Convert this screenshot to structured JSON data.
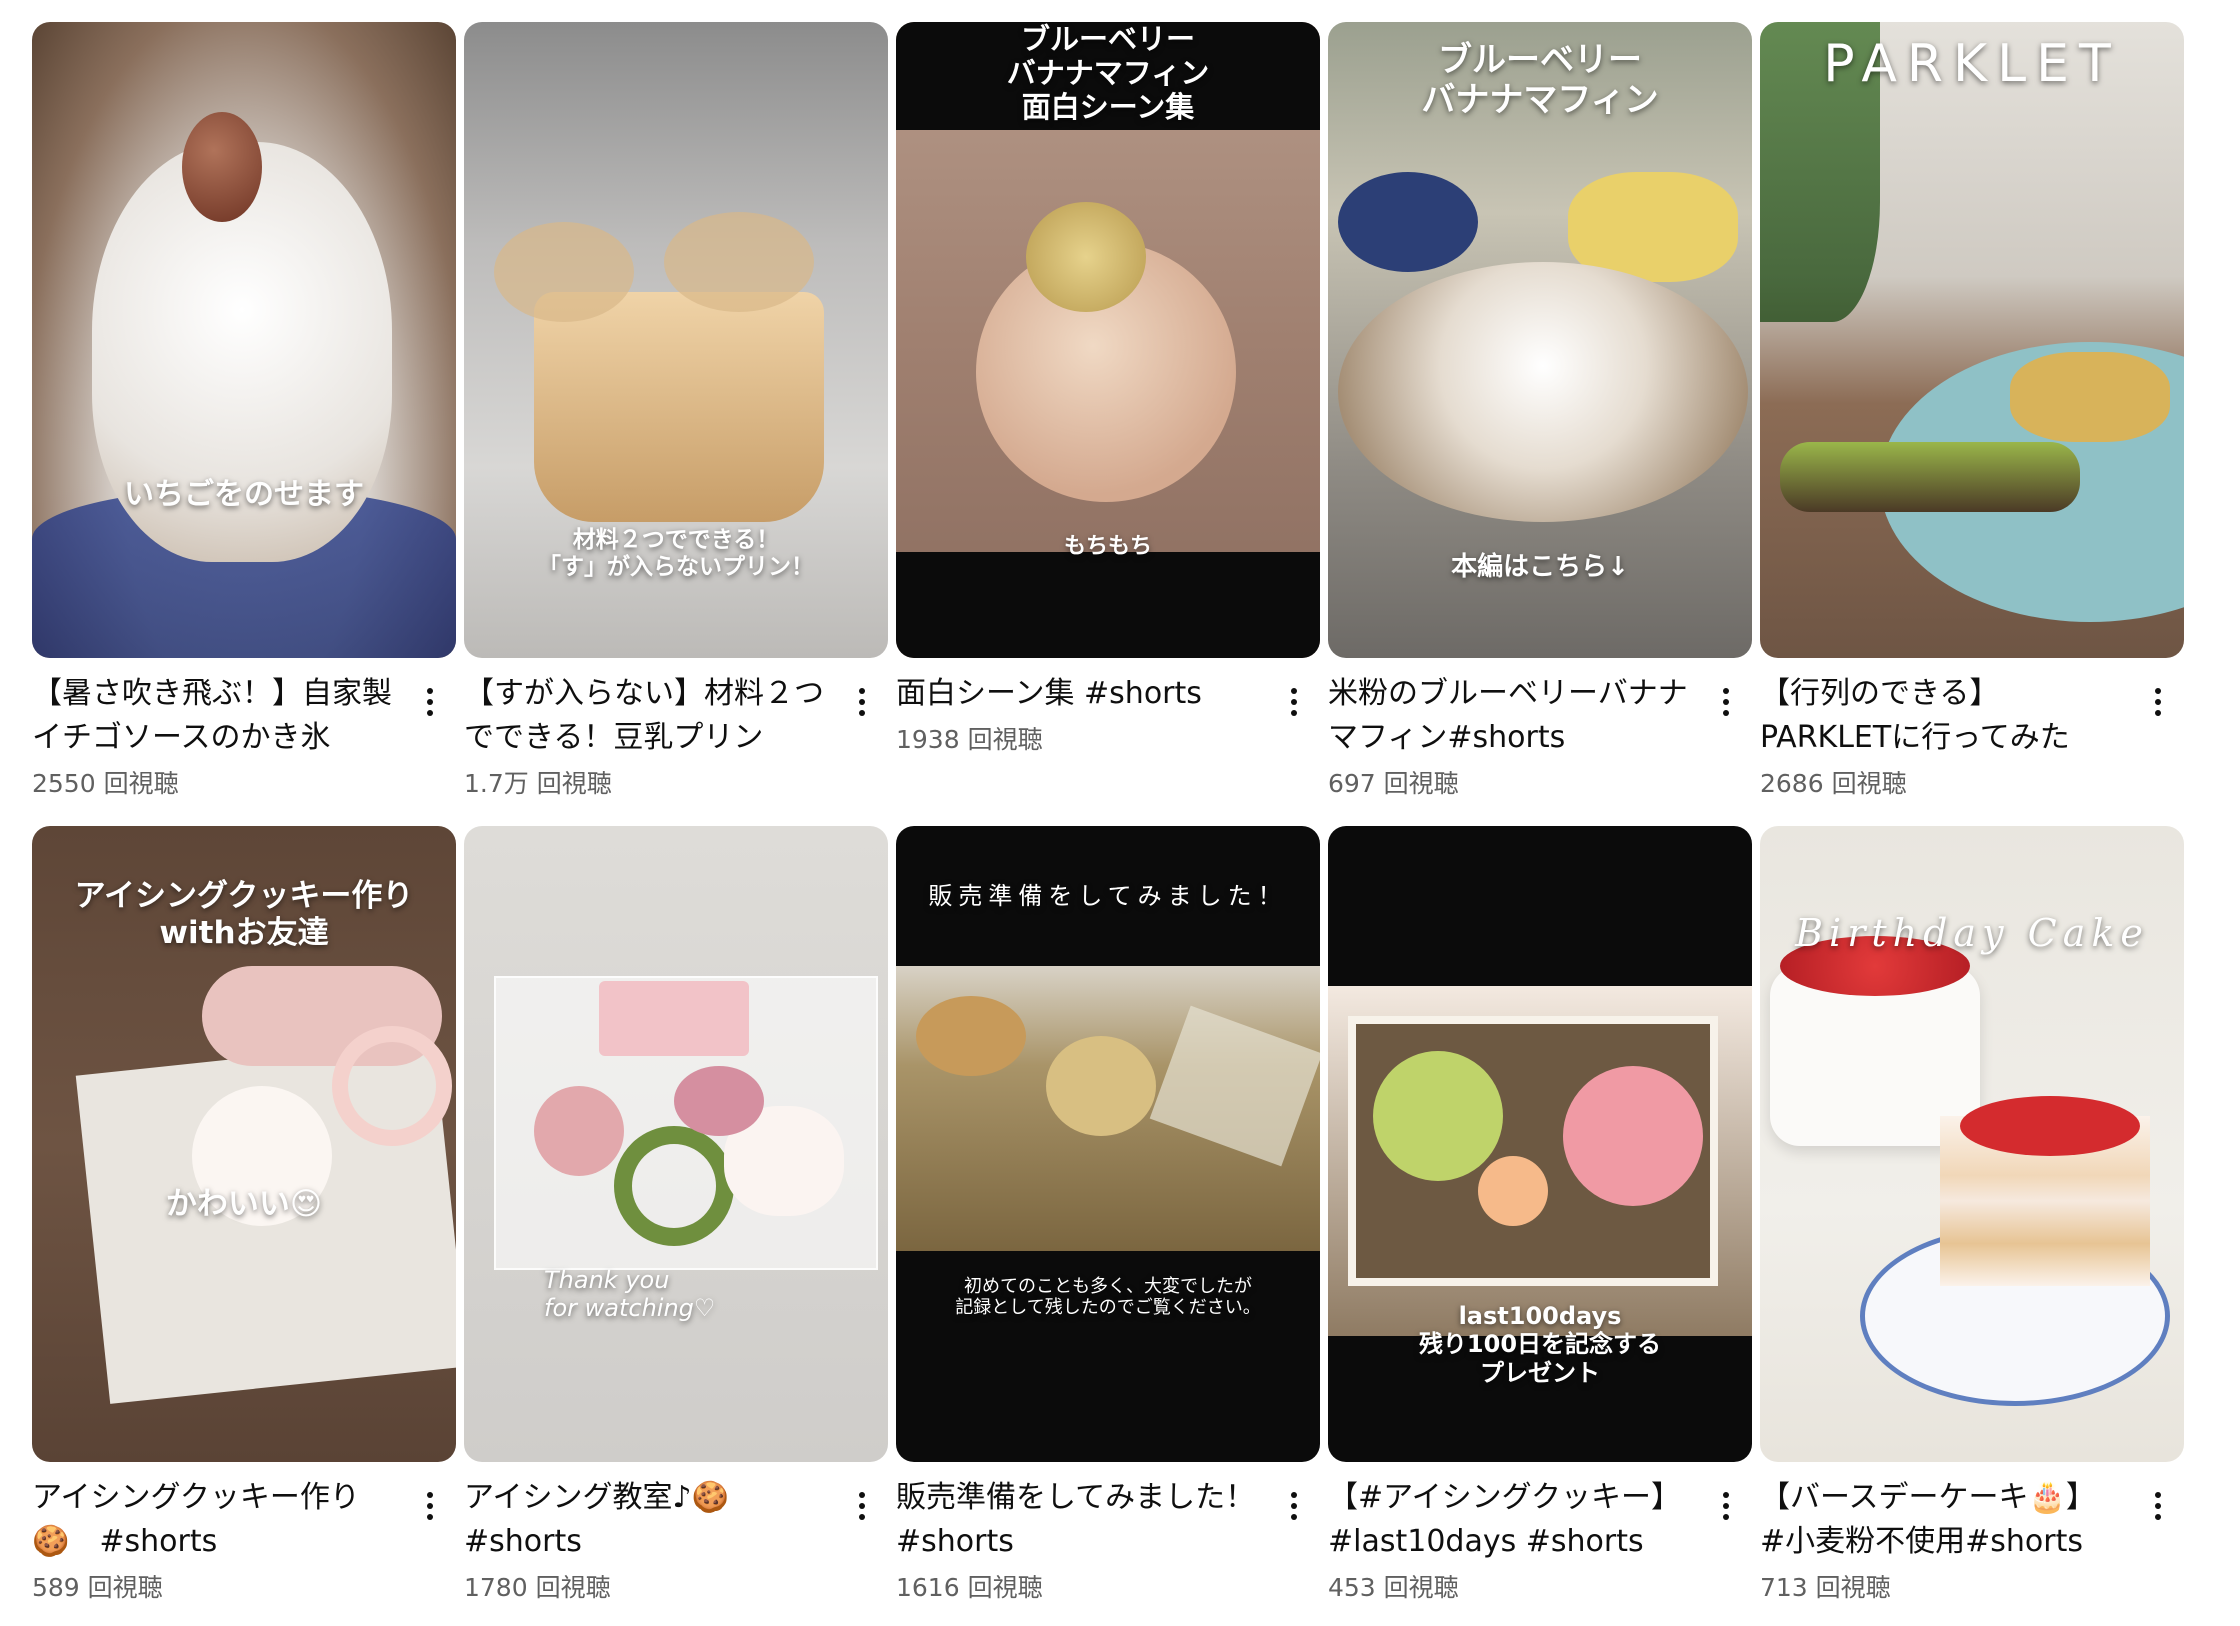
{
  "videos": [
    {
      "title": "【暑さ吹き飛ぶ！】自家製イチゴソースのかき氷",
      "views": "2550 回視聴",
      "overlay": "いちごをのせます"
    },
    {
      "title": "【すが入らない】材料２つでできる！豆乳プリン",
      "views": "1.7万 回視聴",
      "overlay": "材料２つでできる！\n「す」が入らないプリン！"
    },
    {
      "title": "面白シーン集 #shorts",
      "views": "1938 回視聴",
      "overlay_top": "ブルーベリー\nバナナマフィン\n面白シーン集",
      "overlay": "もちもち"
    },
    {
      "title": "米粉のブルーベリーバナナマフィン#shorts",
      "views": "697 回視聴",
      "overlay_top": "ブルーベリー\nバナナマフィン",
      "overlay": "本編はこちら↓"
    },
    {
      "title": "【行列のできる】PARKLETに行ってみた",
      "views": "2686 回視聴",
      "overlay_top": "PARKLET"
    },
    {
      "title": "アイシングクッキー作り🍪　#shorts",
      "views": "589 回視聴",
      "overlay_top": "アイシングクッキー作り\nwithお友達",
      "overlay": "かわいい😍"
    },
    {
      "title": "アイシング教室♪🍪 #shorts",
      "views": "1780 回視聴",
      "overlay": "Thank you\nfor watching♡"
    },
    {
      "title": "販売準備をしてみました！#shorts",
      "views": "1616 回視聴",
      "overlay_top": "販売準備をしてみました！",
      "overlay": "初めてのことも多く、大変でしたが\n記録として残したのでご覧ください。"
    },
    {
      "title": "【#アイシングクッキー】 #last10days #shorts",
      "views": "453 回視聴",
      "overlay": "last100days\n残り100日を記念する\nプレゼント"
    },
    {
      "title": "【バースデーケーキ🎂】#小麦粉不使用#shorts",
      "views": "713 回視聴",
      "overlay_top": "Birthday Cake"
    }
  ],
  "icons": {
    "more": "more-vert-icon"
  }
}
